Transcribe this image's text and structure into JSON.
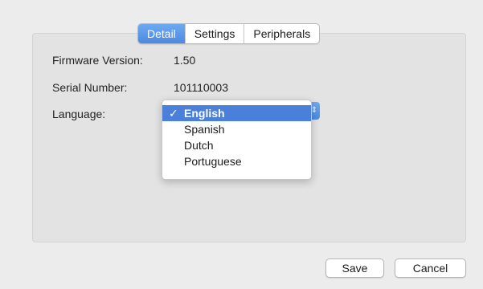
{
  "tabs": [
    {
      "label": "Detail",
      "active": true
    },
    {
      "label": "Settings",
      "active": false
    },
    {
      "label": "Peripherals",
      "active": false
    }
  ],
  "fields": {
    "firmware_label": "Firmware Version:",
    "firmware_value": "1.50",
    "serial_label": "Serial Number:",
    "serial_value": "101110003",
    "language_label": "Language:"
  },
  "language_dropdown": {
    "selected": "English",
    "check_glyph": "✓",
    "options": [
      "English",
      "Spanish",
      "Dutch",
      "Portuguese"
    ]
  },
  "buttons": {
    "save_label": "Save",
    "cancel_label": "Cancel"
  },
  "colors": {
    "accent": "#4a7fda",
    "panel_bg": "#e3e3e3",
    "window_bg": "#ececec"
  }
}
